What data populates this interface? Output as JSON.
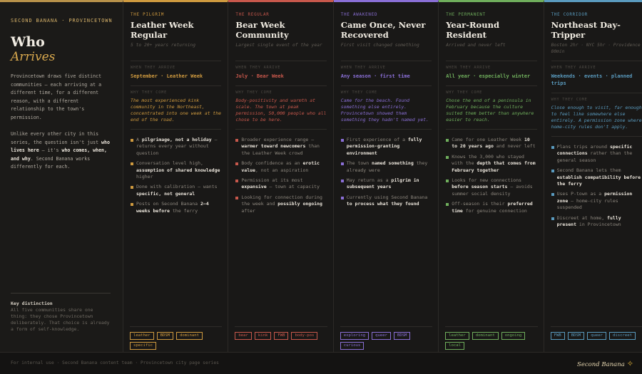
{
  "intro": {
    "kicker": "Second Banana · Provincetown",
    "title_line1": "Who",
    "title_line2": "Arrives",
    "para1": "Provincetown draws five distinct communities — each arriving at a different time, for a different reason, with a different relationship to the town's permission.",
    "para2_a": "Unlike every other city in this series, the question isn't just ",
    "para2_b": "who lives here",
    "para2_c": " — it's ",
    "para2_d": "who comes, when, and why",
    "para2_e": ". Second Banana works differently for each.",
    "key_title": "Key distinction",
    "key_body": "All five communities share one thing: they chose Provincetown deliberately. That choice is already a form of self-knowledge."
  },
  "section_labels": {
    "when": "When they arrive",
    "why": "Why they come"
  },
  "columns": [
    {
      "accent": "#cf9a3f",
      "label": "The Pilgrim",
      "title": "Leather Week Regular",
      "subtitle": "5 to 20+ years returning",
      "when": "September · Leather Week",
      "why": "The most experienced kink community in the Northeast, concentrated into one week at the end of the road.",
      "items": [
        [
          {
            "t": "A "
          },
          {
            "t": "pilgrimage, not a holiday",
            "b": true
          },
          {
            "t": " — returns every year without question"
          }
        ],
        [
          {
            "t": "Conversation level high, "
          },
          {
            "t": "assumption of shared knowledge",
            "b": true
          },
          {
            "t": " higher"
          }
        ],
        [
          {
            "t": "Done with calibration — wants "
          },
          {
            "t": "specific, not general",
            "b": true
          }
        ],
        [
          {
            "t": "Posts on Second Banana "
          },
          {
            "t": "2–4 weeks before",
            "b": true
          },
          {
            "t": " the ferry"
          }
        ]
      ],
      "tags": [
        "leather",
        "BDSM",
        "dominant",
        "specific"
      ]
    },
    {
      "accent": "#c8584c",
      "label": "The Regular",
      "title": "Bear Week Community",
      "subtitle": "Largest single event of the year",
      "when": "July · Bear Week",
      "why": "Body-positivity and warmth at scale. The town at peak permission, 50,000 people who all chose to be here.",
      "items": [
        [
          {
            "t": "Broader experience range — "
          },
          {
            "t": "warmer toward newcomers",
            "b": true
          },
          {
            "t": " than the Leather Week crowd"
          }
        ],
        [
          {
            "t": "Body confidence as an "
          },
          {
            "t": "erotic value",
            "b": true
          },
          {
            "t": ", not an aspiration"
          }
        ],
        [
          {
            "t": "Permission at its most "
          },
          {
            "t": "expansive",
            "b": true
          },
          {
            "t": " — town at capacity"
          }
        ],
        [
          {
            "t": "Looking for connection during the week and "
          },
          {
            "t": "possibly ongoing",
            "b": true
          },
          {
            "t": " after"
          }
        ]
      ],
      "tags": [
        "bear",
        "kink",
        "FWB",
        "body-pos"
      ]
    },
    {
      "accent": "#8a6fd6",
      "label": "The Awakened",
      "title": "Came Once, Never Recovered",
      "subtitle": "First visit changed something",
      "when": "Any season · first time",
      "why": "Came for the beach. Found something else entirely. Provincetown showed them something they hadn't named yet.",
      "items": [
        [
          {
            "t": "First experience of a "
          },
          {
            "t": "fully permission-granting environment",
            "b": true
          }
        ],
        [
          {
            "t": "The town "
          },
          {
            "t": "named something",
            "b": true
          },
          {
            "t": " they already were"
          }
        ],
        [
          {
            "t": "May return as a "
          },
          {
            "t": "pilgrim in subsequent years",
            "b": true
          }
        ],
        [
          {
            "t": "Currently using Second Banana "
          },
          {
            "t": "to process what they found",
            "b": true
          }
        ]
      ],
      "tags": [
        "exploring",
        "queer",
        "BDSM",
        "curious"
      ]
    },
    {
      "accent": "#6fae5c",
      "label": "The Permanent",
      "title": "Year-Round Resident",
      "subtitle": "Arrived and never left",
      "when": "All year · especially winter",
      "why": "Chose the end of a peninsula in February because the culture suited them better than anywhere easier to reach.",
      "items": [
        [
          {
            "t": "Came for one Leather Week "
          },
          {
            "t": "10 to 20 years ago",
            "b": true
          },
          {
            "t": " and never left"
          }
        ],
        [
          {
            "t": "Knows the 3,000 who stayed with the "
          },
          {
            "t": "depth that comes from February together",
            "b": true
          }
        ],
        [
          {
            "t": "Looks for new connections "
          },
          {
            "t": "before season starts",
            "b": true
          },
          {
            "t": " — avoids summer social density"
          }
        ],
        [
          {
            "t": "Off-season is their "
          },
          {
            "t": "preferred time",
            "b": true
          },
          {
            "t": " for genuine connection"
          }
        ]
      ],
      "tags": [
        "leather",
        "dominant",
        "ongoing",
        "local"
      ]
    },
    {
      "accent": "#5a9bbf",
      "label": "The Corridor",
      "title": "Northeast Day-Tripper",
      "subtitle": "Boston 2hr · NYC 5hr · Providence 80min",
      "when": "Weekends · events · planned trips",
      "why": "Close enough to visit, far enough to feel like somewhere else entirely. A permission zone where home-city rules don't apply.",
      "items": [
        [
          {
            "t": "Plans trips around "
          },
          {
            "t": "specific connections",
            "b": true
          },
          {
            "t": " rather than the general season"
          }
        ],
        [
          {
            "t": "Second Banana lets them "
          },
          {
            "t": "establish compatibility before the ferry",
            "b": true
          }
        ],
        [
          {
            "t": "Uses P-town as a "
          },
          {
            "t": "permission zone",
            "b": true
          },
          {
            "t": " — home-city rules suspended"
          }
        ],
        [
          {
            "t": "Discreet at home, "
          },
          {
            "t": "fully present",
            "b": true
          },
          {
            "t": " in Provincetown"
          }
        ]
      ],
      "tags": [
        "FWB",
        "BDSM",
        "queer",
        "discreet"
      ]
    }
  ],
  "footer": {
    "text": "For internal use · Second Banana content team · Provincetown city page series",
    "brand": "Second Banana",
    "brand_icon": "banana-icon"
  }
}
